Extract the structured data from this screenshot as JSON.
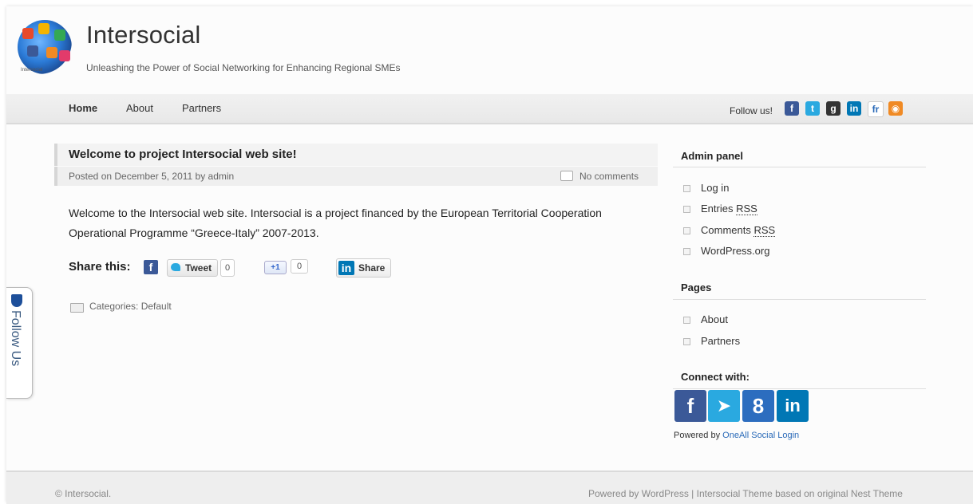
{
  "site": {
    "title": "Intersocial",
    "description": "Unleashing the Power of Social Networking for Enhancing Regional SMEs",
    "logo_caption": "Intersocial"
  },
  "nav": {
    "items": [
      "Home",
      "About",
      "Partners"
    ],
    "follow_label": "Follow us!",
    "social_icons": [
      "facebook-icon",
      "twitter-icon",
      "google-plus-icon",
      "linkedin-icon",
      "friendfeed-icon",
      "rss-icon"
    ]
  },
  "post": {
    "title": "Welcome to project Intersocial web site!",
    "meta": "Posted on December 5, 2011 by admin",
    "comments": "No comments",
    "body": "Welcome to the Intersocial web site. Intersocial is a project financed by the European Territorial Cooperation Operational Programme “Greece-Italy” 2007-2013.",
    "share_label": "Share this:",
    "tweet_label": "Tweet",
    "tweet_count": "0",
    "gplus_label": "+1",
    "gplus_count": "0",
    "linkedin_label": "Share",
    "categories": "Categories: Default"
  },
  "side_tab": {
    "label": "Follow Us"
  },
  "sidebar": {
    "admin_title": "Admin panel",
    "admin_items": [
      "Log in",
      "Entries",
      "Comments",
      "WordPress.org"
    ],
    "rss_abbr": "RSS",
    "pages_title": "Pages",
    "pages_items": [
      "About",
      "Partners"
    ],
    "connect_title": "Connect with:",
    "powered_prefix": "Powered by",
    "powered_link": "OneAll Social Login"
  },
  "footer": {
    "copyright": "© Intersocial.",
    "right": "Powered by WordPress | Intersocial Theme based on original Nest Theme"
  },
  "colors": {
    "facebook": "#3b5998",
    "twitter": "#2aa9e0",
    "google_plus": "#d34836",
    "linkedin": "#0077b5",
    "rss": "#f08a24",
    "link": "#2a6ab8"
  }
}
